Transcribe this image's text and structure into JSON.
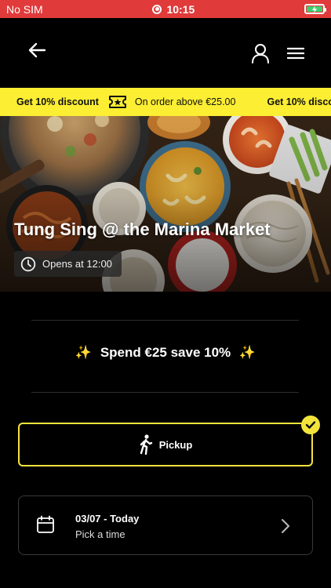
{
  "status_bar": {
    "carrier": "No SIM",
    "time": "10:15"
  },
  "promo_ticker": {
    "label": "Get 10% discount",
    "condition": "On order above €25.00",
    "label_repeat": "Get 10% discou"
  },
  "restaurant": {
    "name": "Tung Sing @ the Marina Market",
    "opens": "Opens at 12:00"
  },
  "promo_banner": {
    "sparkle_left": "✨",
    "text": "Spend €25 save 10%",
    "sparkle_right": "✨"
  },
  "order_type": {
    "label": "Pickup",
    "selected": true
  },
  "schedule": {
    "date": "03/07 - Today",
    "time_hint": "Pick a time"
  },
  "colors": {
    "accent": "#fcee32",
    "status_bar": "#e03a3a",
    "background": "#000000"
  },
  "icons": {
    "back": "arrow-left-icon",
    "user": "user-icon",
    "menu": "hamburger-menu-icon",
    "ticket": "discount-ticket-icon",
    "clock": "clock-icon",
    "walk": "walking-person-icon",
    "check": "check-icon",
    "calendar": "calendar-icon",
    "chevron": "chevron-right-icon"
  }
}
